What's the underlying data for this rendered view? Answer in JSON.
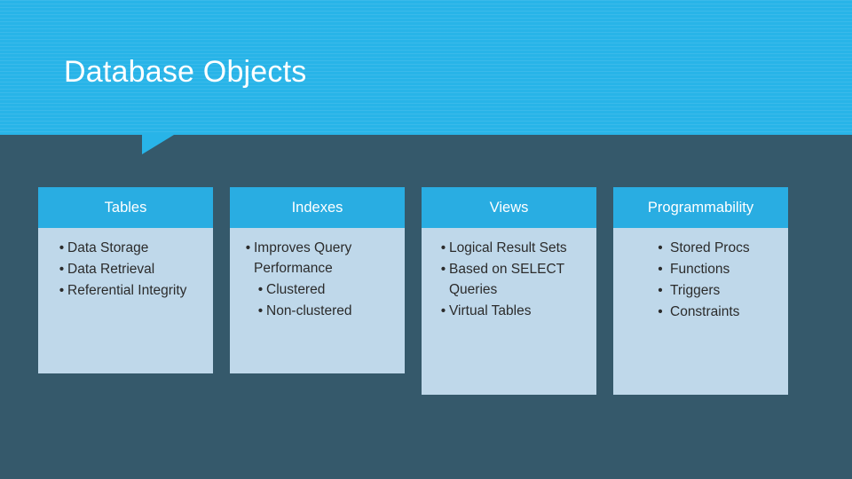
{
  "slide": {
    "title": "Database Objects",
    "bullet_glyph": "•",
    "colors": {
      "background": "#35596b",
      "banner": "#28b4e8",
      "column_header": "#29ade2",
      "column_body": "#bfd8ea",
      "title_text": "#ffffff",
      "body_text": "#2b2b2b"
    },
    "columns": [
      {
        "header": "Tables",
        "items": [
          {
            "text": "Data Storage",
            "level": 1
          },
          {
            "text": "Data Retrieval",
            "level": 1
          },
          {
            "text": "Referential Integrity",
            "level": 1
          }
        ]
      },
      {
        "header": "Indexes",
        "items": [
          {
            "text": "Improves Query Performance",
            "level": 1
          },
          {
            "text": "Clustered",
            "level": 2
          },
          {
            "text": "Non-clustered",
            "level": 2
          }
        ]
      },
      {
        "header": "Views",
        "items": [
          {
            "text": "Logical Result Sets",
            "level": 1
          },
          {
            "text": "Based on SELECT Queries",
            "level": 1
          },
          {
            "text": "Virtual Tables",
            "level": 1
          }
        ]
      },
      {
        "header": "Programmability",
        "items": [
          {
            "text": "Stored Procs",
            "level": 1
          },
          {
            "text": "Functions",
            "level": 1
          },
          {
            "text": "Triggers",
            "level": 1
          },
          {
            "text": "Constraints",
            "level": 1
          }
        ]
      }
    ]
  }
}
